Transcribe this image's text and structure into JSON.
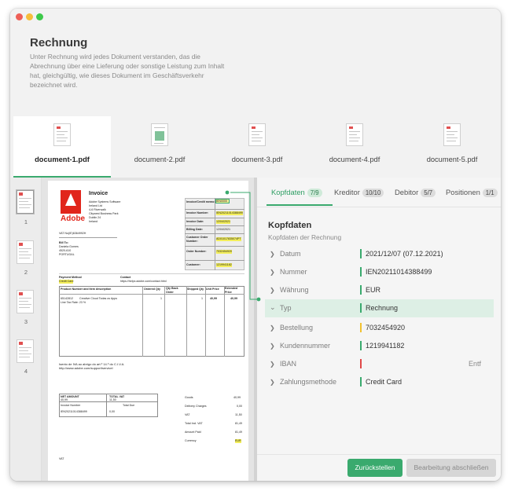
{
  "header": {
    "title": "Rechnung",
    "description": "Unter Rechnung wird jedes Dokument verstanden, das die Abrechnung über eine Lieferung oder sonstige Leistung zum Inhalt hat, gleichgültig, wie dieses Dokument im Geschäftsverkehr bezeichnet wird."
  },
  "documents": [
    {
      "label": "document-1.pdf"
    },
    {
      "label": "document-2.pdf"
    },
    {
      "label": "document-3.pdf"
    },
    {
      "label": "document-4.pdf"
    },
    {
      "label": "document-5.pdf"
    }
  ],
  "pages": [
    {
      "num": "1"
    },
    {
      "num": "2"
    },
    {
      "num": "3"
    },
    {
      "num": "4"
    }
  ],
  "invoice": {
    "brand": "Adobe",
    "title": "Invoice",
    "company": [
      "Adobe Systems Software",
      "Ireland Ltd",
      "4-6 Riverwalk",
      "Citywest Business Park",
      "Dublin 24",
      "Ireland"
    ],
    "vat_line": "VAT No(IE)6364992H",
    "bill_to": [
      "Bill To:",
      "Daniela Gomes",
      "4520-610",
      "PORTUGAL"
    ],
    "meta_labels": [
      "Invoice/Credit memo:",
      "Invoice Number:",
      "Invoice Date:",
      "Billing Date:",
      "Customer Order Number:",
      "Order Number:",
      "Customer:"
    ],
    "meta_values": [
      "IEN0000",
      "IEN20211014388499",
      "12/04/2021",
      "12/04/2021",
      "AD01017835074PT",
      "7032454920",
      "1219941182"
    ],
    "payment_method_label": "Payment Method",
    "payment_method_value": "Credit Card",
    "contact_label": "Contact",
    "contact_value": "https://helpx.adobe.com/contact.html",
    "columns": [
      "Product Number and Item description",
      "Ordered Qty",
      "Qty Back Order",
      "Shipped Qty",
      "Unit Price",
      "Extended Price"
    ],
    "item_code": "65142812",
    "item_desc": "Creative Cloud Todas os Apps",
    "item_tax": "Line Tax Rate: 23 %",
    "item_ordered": "1",
    "item_shipped": "1",
    "item_unit": "40,99",
    "item_ext": "40,99",
    "notes": [
      "Isento de IVA ao abrigo do art.º 14.º do C.I.V.A.",
      "http://www.adobe.com/support/servicel"
    ],
    "net_label": "NET AMOUNT",
    "net_value": "40,99",
    "total_vat_label": "TOTAL VAT",
    "total_vat_value": "11,50",
    "inv_number_label": "Invoice Number",
    "inv_number_value": "IEN20211014388499",
    "total_due_label": "Total Due",
    "total_due_value": "0,00",
    "totals_labels": [
      "Goods",
      "Delivery Charges",
      "VAT",
      "Total Incl. VAT",
      "Amount Paid",
      "Currency"
    ],
    "totals_values": [
      "40,99",
      "0,00",
      "11,50",
      "81,49",
      "81,49",
      "EUR"
    ],
    "footer_text": "VAT"
  },
  "details": {
    "tabs": [
      {
        "label": "Kopfdaten",
        "badge": "7/9"
      },
      {
        "label": "Kreditor",
        "badge": "10/10"
      },
      {
        "label": "Debitor",
        "badge": "5/7"
      },
      {
        "label": "Positionen",
        "badge": "1/1"
      }
    ],
    "section_title": "Kopfdaten",
    "section_subtitle": "Kopfdaten der Rechnung",
    "fields": [
      {
        "label": "Datum",
        "value": "2021/12/07 (07.12.2021)",
        "status_color": "#3aaa6e",
        "extra": ""
      },
      {
        "label": "Nummer",
        "value": "IEN20211014388499",
        "status_color": "#3aaa6e",
        "extra": ""
      },
      {
        "label": "Währung",
        "value": "EUR",
        "status_color": "#3aaa6e",
        "extra": ""
      },
      {
        "label": "Typ",
        "value": "Rechnung",
        "status_color": "#3aaa6e",
        "extra": ""
      },
      {
        "label": "Bestellung",
        "value": "7032454920",
        "status_color": "#f2c230",
        "extra": ""
      },
      {
        "label": "Kundennummer",
        "value": "1219941182",
        "status_color": "#3aaa6e",
        "extra": ""
      },
      {
        "label": "IBAN",
        "value": "",
        "status_color": "#e04848",
        "extra": "Entf"
      },
      {
        "label": "Zahlungsmethode",
        "value": "Credit Card",
        "status_color": "#3aaa6e",
        "extra": ""
      }
    ],
    "buttons": {
      "reset": "Zurückstellen",
      "finish": "Bearbeitung abschließen"
    }
  },
  "colors": {
    "accent": "#3aaa6e",
    "warning": "#f2c230",
    "error": "#e04848"
  }
}
